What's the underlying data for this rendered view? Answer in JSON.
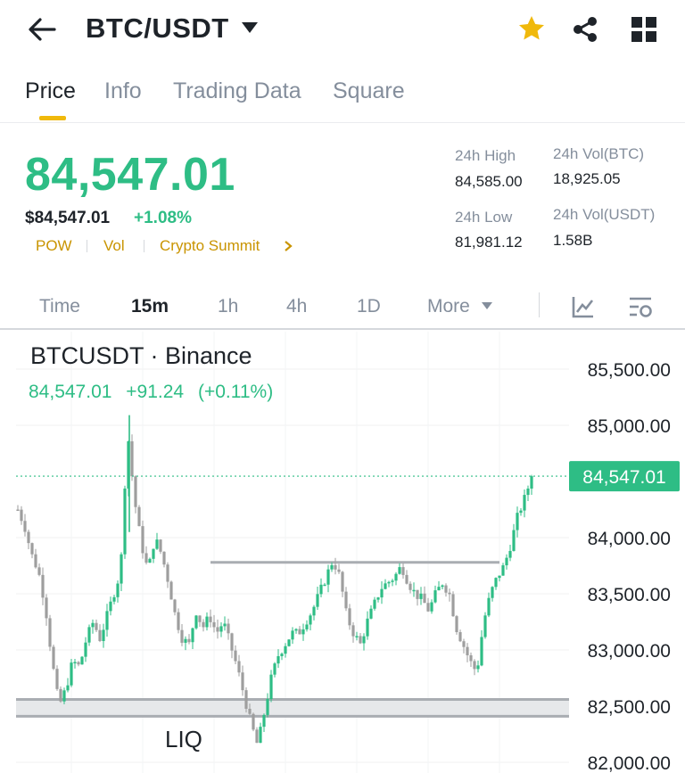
{
  "header": {
    "pair": "BTC/USDT"
  },
  "tabs": [
    {
      "label": "Price",
      "active": true
    },
    {
      "label": "Info",
      "active": false
    },
    {
      "label": "Trading Data",
      "active": false
    },
    {
      "label": "Square",
      "active": false
    }
  ],
  "ticker": {
    "last_price": "84,547.01",
    "fiat_price": "$84,547.01",
    "change_pct": "+1.08%",
    "tags": [
      "POW",
      "Vol",
      "Crypto Summit"
    ],
    "high_label": "24h High",
    "high_value": "84,585.00",
    "low_label": "24h Low",
    "low_value": "81,981.12",
    "vol_btc_label": "24h Vol(BTC)",
    "vol_btc_value": "18,925.05",
    "vol_usdt_label": "24h Vol(USDT)",
    "vol_usdt_value": "1.58B"
  },
  "intervals": [
    {
      "label": "Time",
      "active": false
    },
    {
      "label": "15m",
      "active": true
    },
    {
      "label": "1h",
      "active": false
    },
    {
      "label": "4h",
      "active": false
    },
    {
      "label": "1D",
      "active": false
    },
    {
      "label": "More",
      "active": false
    }
  ],
  "colors": {
    "up": "#2ebd85",
    "down": "#9e9e9e",
    "accent": "#f0b90b",
    "level_line": "#a9adb2"
  },
  "chart_data": {
    "type": "candlestick",
    "title": "BTCUSDT · Binance",
    "last_value": "84,547.01",
    "change_abs": "+91.24",
    "change_pct": "(+0.11%)",
    "last_price_label": "84,547.01",
    "annotation": "LIQ",
    "ylim": [
      82000,
      85500
    ],
    "yticks": [
      "85,500.00",
      "85,000.00",
      "84,000.00",
      "83,500.00",
      "83,000.00",
      "82,500.00",
      "82,000.00"
    ],
    "ytick_values": [
      85500,
      85000,
      84000,
      83500,
      83000,
      82500,
      82000
    ],
    "last_price": 84547.01,
    "resistance": 83780,
    "support_zone": [
      82410,
      82560
    ],
    "close_path": [
      84250,
      84100,
      83850,
      83700,
      83400,
      82900,
      82500,
      82650,
      82900,
      82850,
      83100,
      83250,
      83100,
      83300,
      83500,
      83700,
      84950,
      84350,
      83950,
      83700,
      84000,
      83850,
      83600,
      83300,
      83100,
      83050,
      83350,
      83200,
      83300,
      83150,
      83250,
      83050,
      82850,
      82600,
      82350,
      82150,
      82450,
      82750,
      82950,
      83050,
      83150,
      83150,
      83250,
      83350,
      83500,
      83650,
      83800,
      83650,
      83300,
      83150,
      83050,
      83250,
      83400,
      83550,
      83600,
      83650,
      83750,
      83600,
      83500,
      83450,
      83350,
      83500,
      83600,
      83500,
      83200,
      83050,
      82900,
      82800,
      83250,
      83500,
      83650,
      83750,
      83950,
      84200,
      84350,
      84547
    ]
  }
}
